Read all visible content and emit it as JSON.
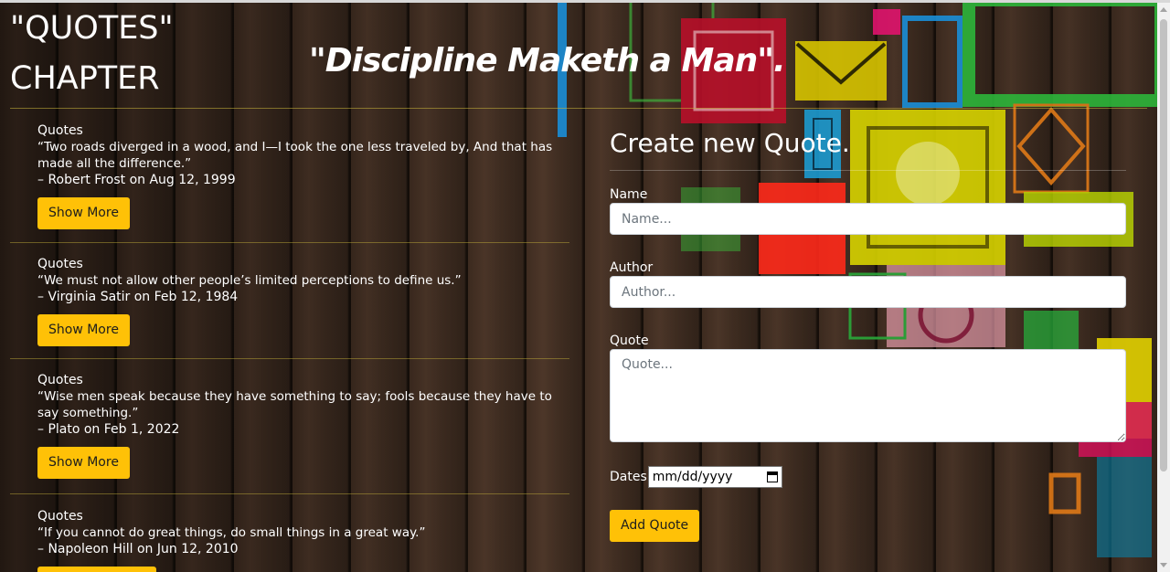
{
  "brand": {
    "line1": "\"QUOTES\"",
    "line2": "CHAPTER"
  },
  "slogan": "\"Discipline Maketh a Man\".",
  "quotes": [
    {
      "heading": "Quotes",
      "text": "“Two roads diverged in a wood, and I—I took the one less traveled by, And that has made all the difference.”",
      "meta": "– Robert Frost on Aug 12, 1999",
      "button": "Show More"
    },
    {
      "heading": "Quotes",
      "text": "“We must not allow other people’s limited perceptions to define us.”",
      "meta": "– Virginia Satir on Feb 12, 1984",
      "button": "Show More"
    },
    {
      "heading": "Quotes",
      "text": "“Wise men speak because they have something to say; fools because they have to say something.”",
      "meta": "– Plato on Feb 1, 2022",
      "button": "Show More"
    },
    {
      "heading": "Quotes",
      "text": "“If you cannot do great things, do small things in a great way.”",
      "meta": "– Napoleon Hill on Jun 12, 2010",
      "button": ""
    }
  ],
  "form": {
    "title": "Create new Quote.",
    "name_label": "Name",
    "name_placeholder": "Name...",
    "author_label": "Author",
    "author_placeholder": "Author...",
    "quote_label": "Quote",
    "quote_placeholder": "Quote...",
    "dates_label": "Dates",
    "dates_value": "mm/dd/yyyy",
    "submit_label": "Add Quote"
  },
  "colors": {
    "accent": "#ffc107",
    "rule": "#c8b43c"
  }
}
